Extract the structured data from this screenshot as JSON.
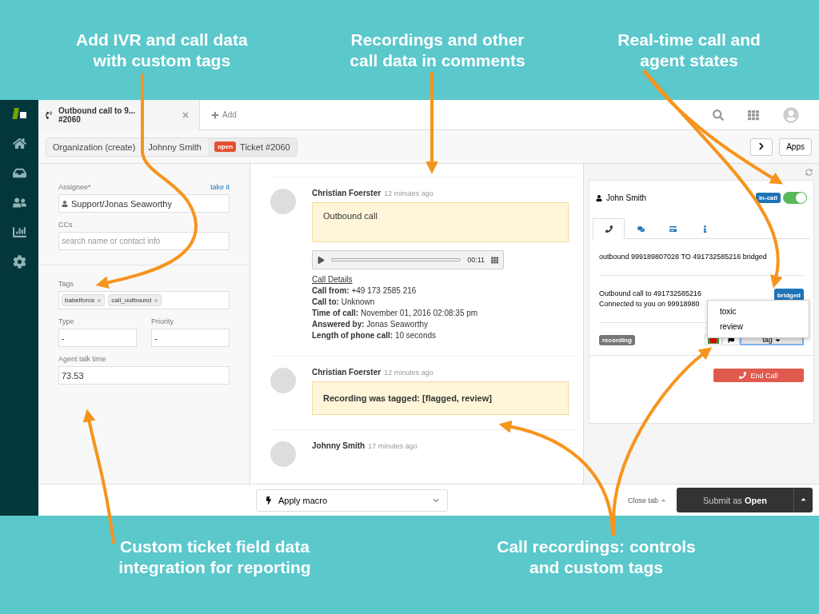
{
  "captions_top": [
    "Add IVR and call data with custom tags",
    "Recordings and other call data in comments",
    "Real-time call and agent states"
  ],
  "captions_bottom": [
    "Custom ticket field data integration for reporting",
    "Call recordings: controls and custom tags"
  ],
  "app": {
    "ticket_tab": {
      "title": "Outbound call to 9...",
      "number": "#2060"
    },
    "add_tab": "Add",
    "breadcrumbs": [
      {
        "kind": "link",
        "label": "Organization (create)"
      },
      {
        "kind": "link",
        "label": "Johnny Smith"
      },
      {
        "kind": "ticket",
        "badge": "open",
        "label": "Ticket #2060"
      }
    ],
    "apps_button": "Apps",
    "fields": {
      "assignee_label": "Assignee*",
      "take_it": "take it",
      "assignee": "Support/Jonas Seaworthy",
      "ccs_label": "CCs",
      "ccs_placeholder": "search name or contact info",
      "tags_label": "Tags",
      "tags": [
        "babelforce",
        "call_outbound"
      ],
      "type_label": "Type",
      "type": "-",
      "priority_label": "Priority",
      "priority": "-",
      "talk_time_label": "Agent talk time",
      "talk_time": "73.53"
    },
    "comments": [
      {
        "author": "Christian Foerster",
        "time": "12 minutes ago",
        "body": "Outbound call",
        "bold_body": false,
        "player_time": "00:11",
        "details_title": "Call Details",
        "details": [
          "**Call from:** +49 173 2585 216",
          "**Call to:** Unknown",
          "**Time of call:** November 01, 2016 02:08:35 pm",
          "**Answered by:** Jonas Seaworthy",
          "**Length of phone call:** 10 seconds"
        ]
      },
      {
        "author": "Christian Foerster",
        "time": "12 minutes ago",
        "body": "Recording was tagged: [flagged, review]",
        "bold_body": true
      },
      {
        "author": "Johnny Smith",
        "time": "17 minutes ago"
      }
    ],
    "footer": {
      "macro": "Apply macro",
      "close_tab": "Close tab",
      "submit": "Submit as **Open**"
    },
    "call_app": {
      "caller": "John Smith",
      "state_badge": "in-call",
      "available": true,
      "tabs": [
        {
          "kind": "phone",
          "selected": true
        },
        {
          "kind": "chat",
          "selected": false
        },
        {
          "kind": "card",
          "selected": false
        },
        {
          "kind": "info",
          "selected": false
        }
      ],
      "events": [
        {
          "lines": [
            "outbound 999189807028 TO 491732585216 bridged"
          ]
        },
        {
          "lines": [
            "Outbound call to 491732585216",
            "Connected to you on 99918980"
          ],
          "badge": "bridged"
        }
      ],
      "recording_badge": "recording",
      "tag_menu": [
        "toxic",
        "review"
      ],
      "tag_button": "tag",
      "end_call": "End Call"
    }
  }
}
